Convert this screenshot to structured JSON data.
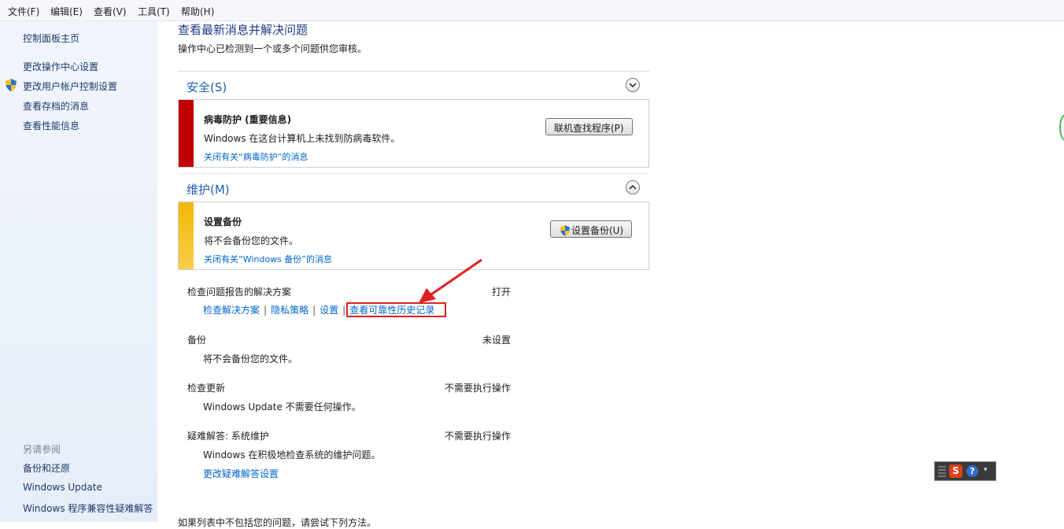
{
  "menubar": {
    "items": [
      "文件(F)",
      "编辑(E)",
      "查看(V)",
      "工具(T)",
      "帮助(H)"
    ]
  },
  "sidebar": {
    "links": [
      "控制面板主页",
      "更改操作中心设置",
      "更改用户帐户控制设置",
      "查看存档的消息",
      "查看性能信息"
    ],
    "see_also_heading": "另请参阅",
    "see_also": [
      "备份和还原",
      "Windows Update",
      "Windows 程序兼容性疑难解答"
    ]
  },
  "main": {
    "title": "查看最新消息并解决问题",
    "subtitle": "操作中心已检测到一个或多个问题供您审核。",
    "security": {
      "title": "安全(S)",
      "card": {
        "title": "病毒防护 (重要信息)",
        "text": "Windows 在这台计算机上未找到防病毒软件。",
        "link": "关闭有关“病毒防护”的消息",
        "button": "联机查找程序(P)",
        "stripe_color": "#c00000"
      }
    },
    "maintenance": {
      "title": "维护(M)",
      "card": {
        "title": "设置备份",
        "text": "将不会备份您的文件。",
        "link": "关闭有关“Windows 备份”的消息",
        "button": "设置备份(U)",
        "stripe_color": "#f2b705"
      },
      "problem_reports": {
        "label": "检查问题报告的解决方案",
        "status": "打开",
        "links": [
          "检查解决方案",
          "隐私策略",
          "设置",
          "查看可靠性历史记录"
        ]
      },
      "backup": {
        "label": "备份",
        "status": "未设置",
        "detail": "将不会备份您的文件。"
      },
      "updates": {
        "label": "检查更新",
        "status": "不需要执行操作",
        "detail": "Windows Update 不需要任何操作。"
      },
      "troubleshooting": {
        "label": "疑难解答: 系统维护",
        "status": "不需要执行操作",
        "detail": "Windows 在积极地检查系统的维护问题。",
        "link": "更改疑难解答设置"
      }
    },
    "cut_text": "如果列表中不包括您的问题，请尝试下列方法。"
  },
  "colors": {
    "annotation": "#e02020",
    "link": "#0066cc"
  }
}
